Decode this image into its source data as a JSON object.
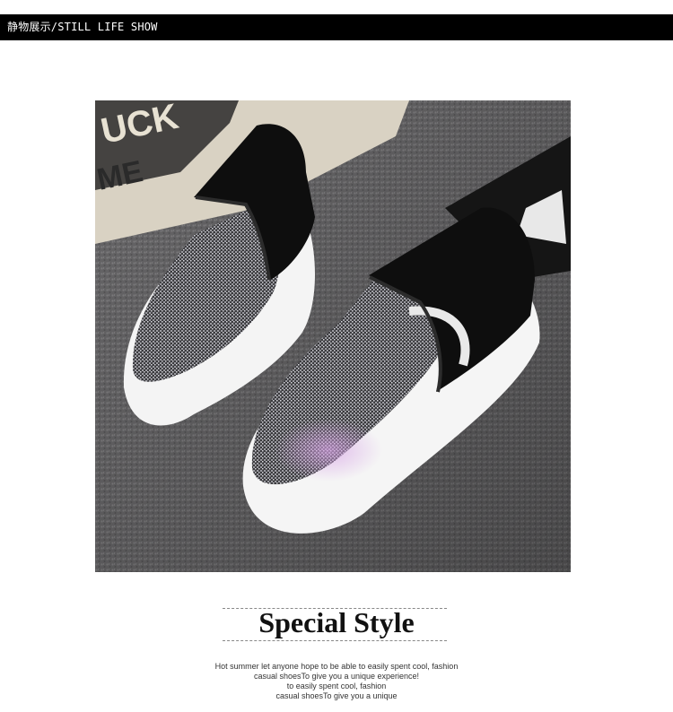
{
  "header": {
    "title": "静物展示/STILL LIFE SHOW"
  },
  "photo": {
    "subject": "metallic slip-on sneaker pair"
  },
  "caption": {
    "title": "Special Style",
    "lines": [
      "Hot summer let anyone hope to be able to easily spent cool, fashion",
      "casual shoesTo give you a unique experience!",
      "to easily spent cool, fashion",
      "casual shoesTo give you a unique"
    ]
  }
}
